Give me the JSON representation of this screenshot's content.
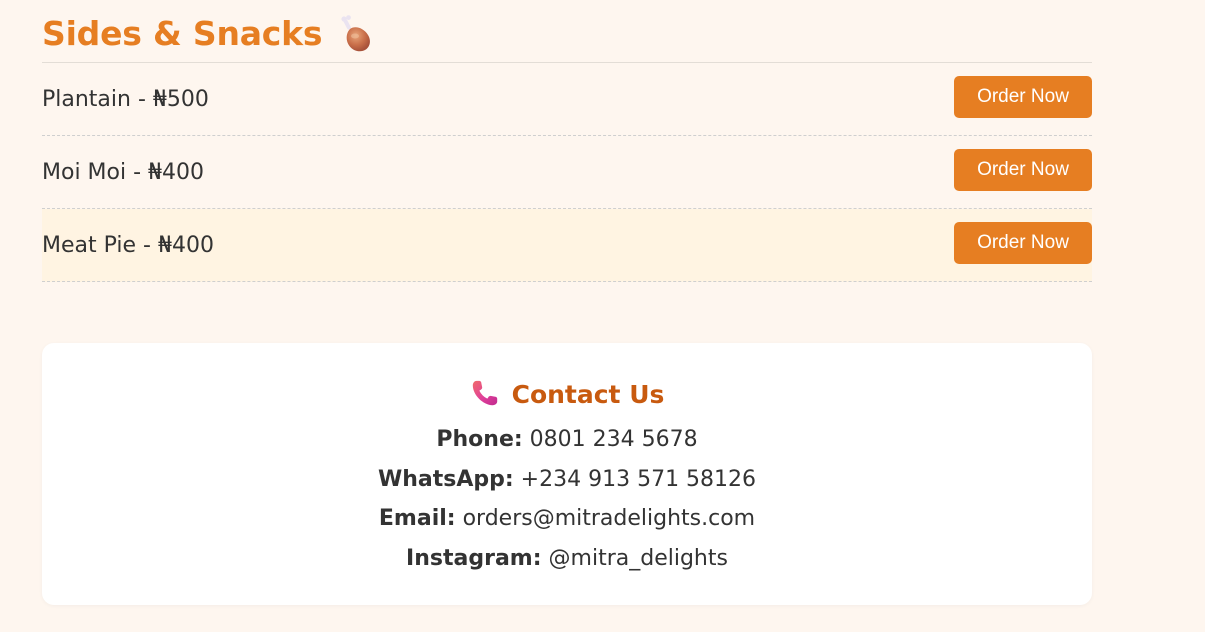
{
  "menu_section": {
    "title": "Sides & Snacks",
    "icon": "chicken-leg-icon",
    "items": [
      {
        "text": "Plantain - ₦500",
        "button_label": "Order Now",
        "highlighted": false
      },
      {
        "text": "Moi Moi - ₦400",
        "button_label": "Order Now",
        "highlighted": false
      },
      {
        "text": "Meat Pie - ₦400",
        "button_label": "Order Now",
        "highlighted": true
      }
    ]
  },
  "contact": {
    "title": "Contact Us",
    "icon": "phone-icon",
    "phone_label": "Phone:",
    "phone_value": "0801 234 5678",
    "whatsapp_label": "WhatsApp:",
    "whatsapp_value": "+234 913 571 58126",
    "email_label": "Email:",
    "email_value": "orders@mitradelights.com",
    "instagram_label": "Instagram:",
    "instagram_value": "@mitra_delights"
  },
  "colors": {
    "background": "#fef6ef",
    "accent": "#e67e22",
    "contact_heading": "#c85a0f",
    "highlight_row": "#fff4e2"
  }
}
